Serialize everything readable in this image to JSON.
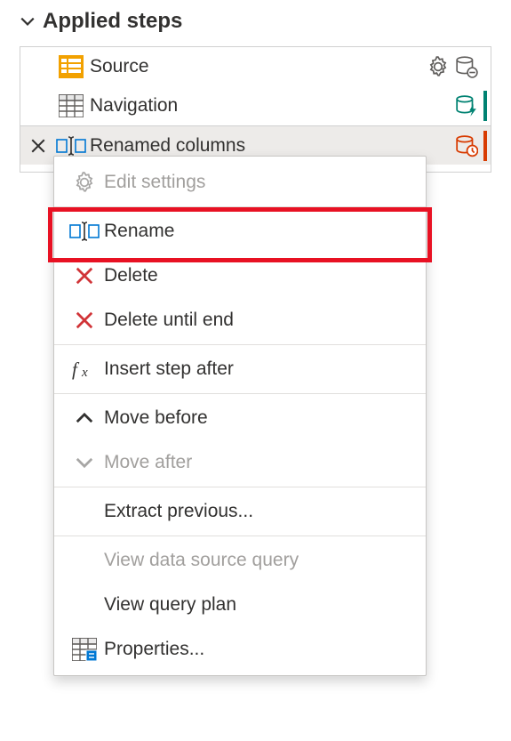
{
  "panel": {
    "title": "Applied steps"
  },
  "steps": [
    {
      "label": "Source"
    },
    {
      "label": "Navigation"
    },
    {
      "label": "Renamed columns"
    }
  ],
  "menu": {
    "edit_settings": "Edit settings",
    "rename": "Rename",
    "delete": "Delete",
    "delete_until_end": "Delete until end",
    "insert_step_after": "Insert step after",
    "move_before": "Move before",
    "move_after": "Move after",
    "extract_previous": "Extract previous...",
    "view_data_source_query": "View data source query",
    "view_query_plan": "View query plan",
    "properties": "Properties..."
  }
}
